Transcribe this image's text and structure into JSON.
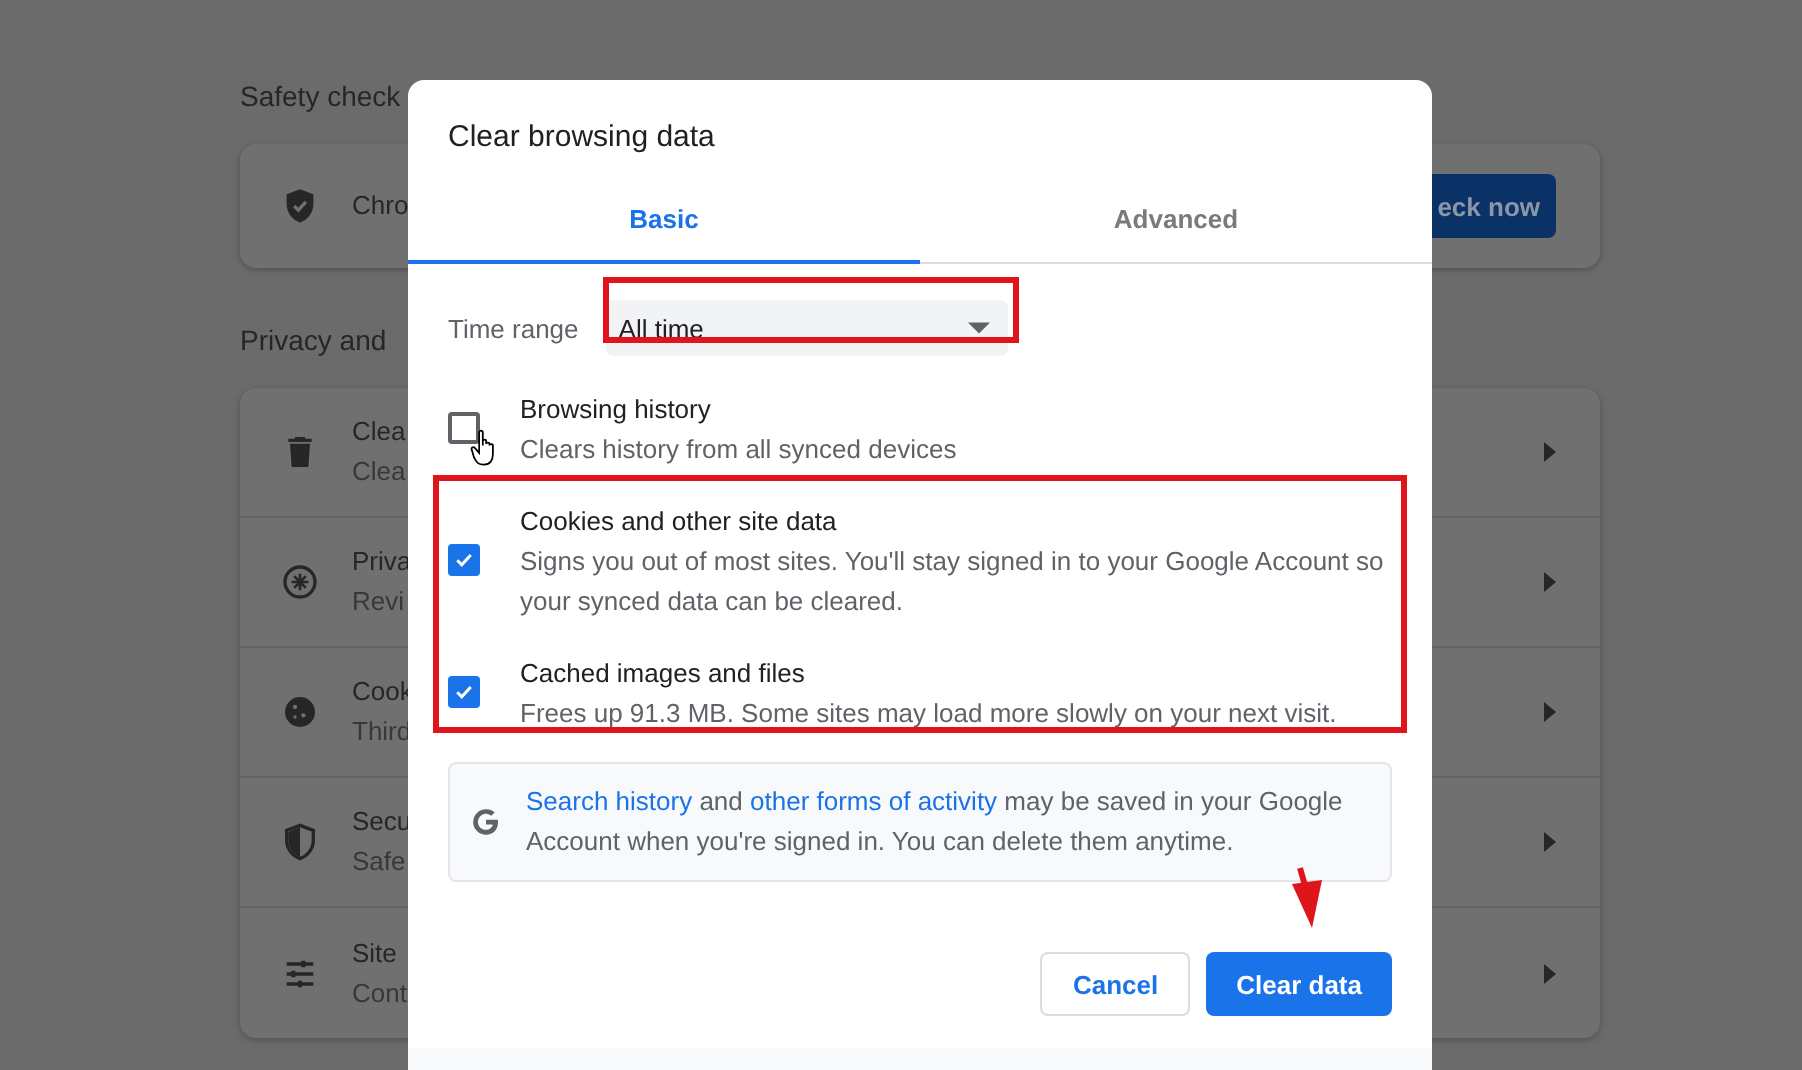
{
  "background": {
    "sections": [
      {
        "heading": "Safety check",
        "rows": [
          {
            "kind": "shield",
            "title": "Chro",
            "button": "eck now"
          }
        ]
      },
      {
        "heading": "Privacy and",
        "rows": [
          {
            "kind": "trash",
            "title": "Clea",
            "subtitle": "Clea"
          },
          {
            "kind": "compass",
            "title": "Priva",
            "subtitle": "Revi"
          },
          {
            "kind": "cookie",
            "title": "Cook",
            "subtitle": "Third"
          },
          {
            "kind": "shield-half",
            "title": "Secu",
            "subtitle": "Safe"
          },
          {
            "kind": "sliders",
            "title": "Site",
            "subtitle": "Cont"
          }
        ]
      }
    ]
  },
  "dialog": {
    "title": "Clear browsing data",
    "tabs": [
      {
        "label": "Basic",
        "selected": true
      },
      {
        "label": "Advanced",
        "selected": false
      }
    ],
    "time_range": {
      "label": "Time range",
      "value": "All time"
    },
    "items": [
      {
        "title": "Browsing history",
        "description": "Clears history from all synced devices",
        "checked": false
      },
      {
        "title": "Cookies and other site data",
        "description": "Signs you out of most sites. You'll stay signed in to your Google Account so your synced data can be cleared.",
        "checked": true
      },
      {
        "title": "Cached images and files",
        "description": "Frees up 91.3 MB. Some sites may load more slowly on your next visit.",
        "checked": true
      }
    ],
    "notice": [
      {
        "text": "Search history",
        "link": true
      },
      {
        "text": " and ",
        "link": false
      },
      {
        "text": "other forms of activity",
        "link": true
      },
      {
        "text": " may be saved in your Google Account when you're signed in. You can delete them anytime.",
        "link": false
      }
    ],
    "buttons": [
      {
        "label": "Cancel",
        "kind": "secondary"
      },
      {
        "label": "Clear data",
        "kind": "primary"
      }
    ]
  }
}
